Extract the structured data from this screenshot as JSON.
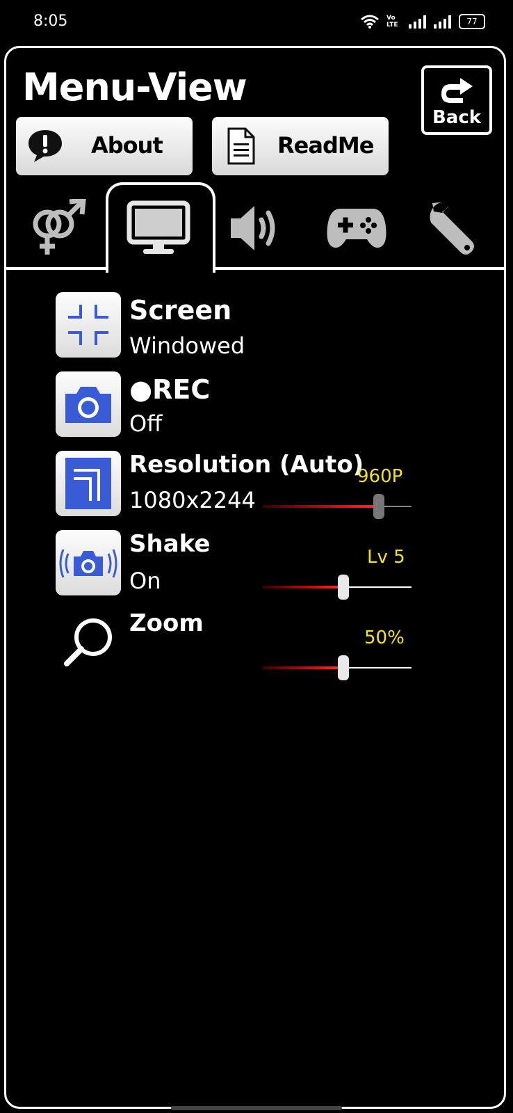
{
  "status_bar": {
    "time": "8:05",
    "volte": "Vo LTE",
    "battery": "77"
  },
  "header": {
    "title": "Menu-View",
    "back_label": "Back"
  },
  "buttons": {
    "about": "About",
    "readme": "ReadMe"
  },
  "tabs": [
    {
      "icon": "gender-icon",
      "active": false
    },
    {
      "icon": "monitor-icon",
      "active": true
    },
    {
      "icon": "speaker-icon",
      "active": false
    },
    {
      "icon": "gamepad-icon",
      "active": false
    },
    {
      "icon": "wrench-icon",
      "active": false
    }
  ],
  "settings": {
    "screen": {
      "label": "Screen",
      "value": "Windowed",
      "icon": "fullscreen-exit-icon"
    },
    "rec": {
      "label": "●REC",
      "value": "Off",
      "icon": "camera-icon"
    },
    "resolution": {
      "label": "Resolution  (Auto)",
      "value": "1080x2244",
      "slider_text": "960P",
      "slider_fraction": 0.78,
      "enabled": false,
      "icon": "resolution-icon"
    },
    "shake": {
      "label": "Shake",
      "value": "On",
      "slider_text": "Lv 5",
      "slider_fraction": 0.54,
      "icon": "camera-shake-icon"
    },
    "zoom": {
      "label": "Zoom",
      "slider_text": "50%",
      "slider_fraction": 0.54,
      "icon": "magnifier-icon"
    }
  },
  "colors": {
    "accent_blue": "#3a5bd6",
    "value_yellow": "#f5e31c",
    "slider_red": "#e01010"
  }
}
